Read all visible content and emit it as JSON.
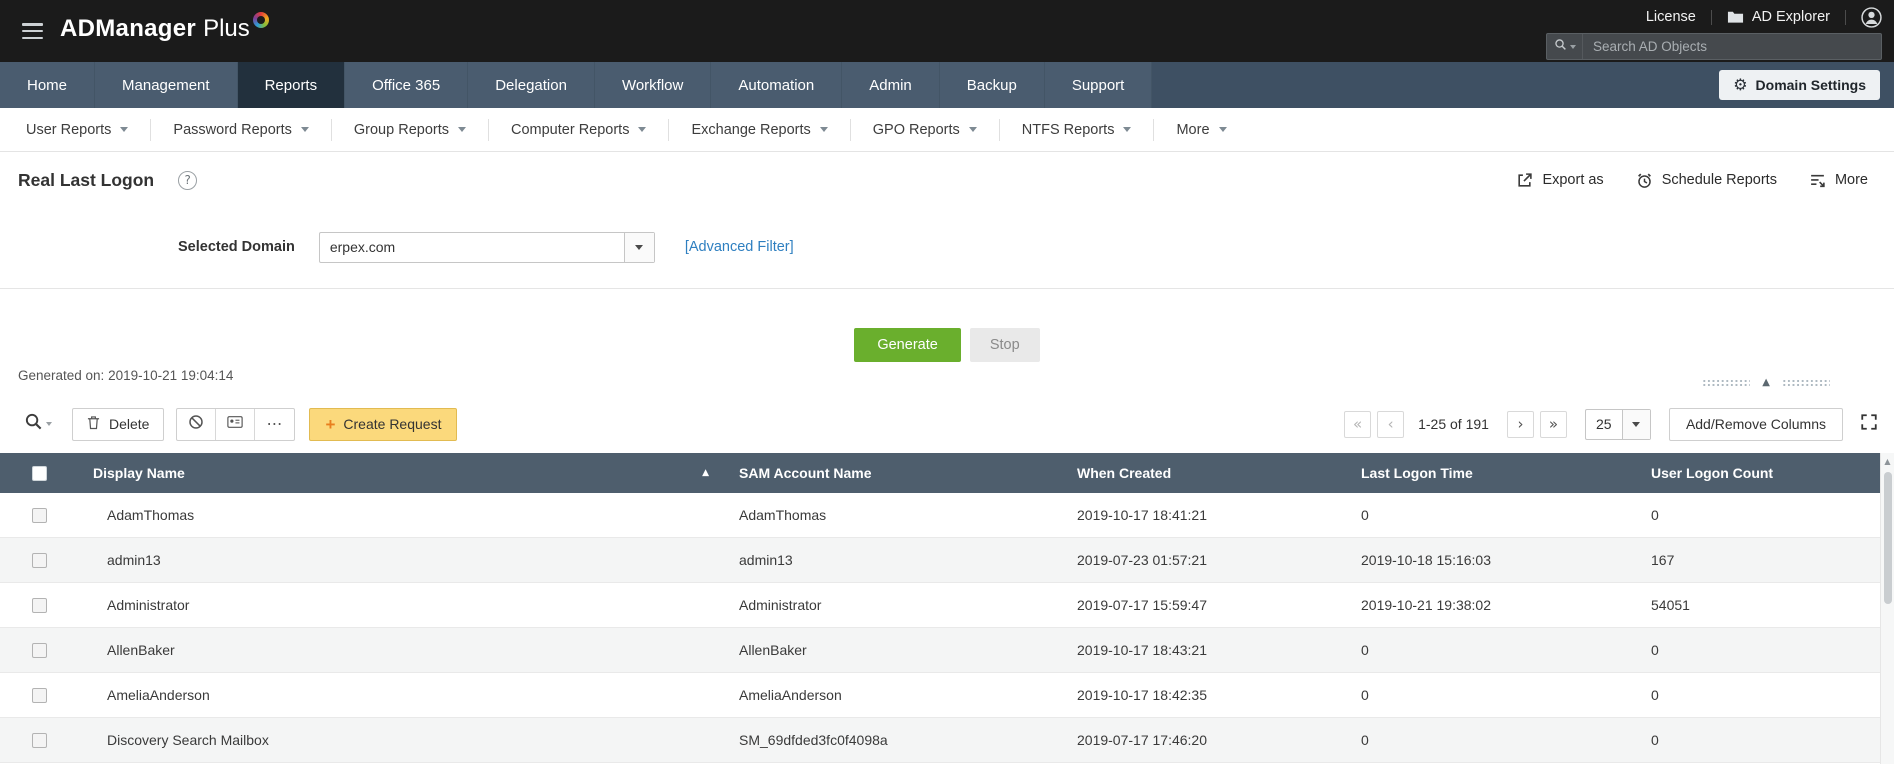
{
  "topbar": {
    "brand": {
      "primary": "ADManager",
      "secondary": "Plus"
    },
    "license_label": "License",
    "ad_explorer_label": "AD Explorer",
    "search_placeholder": "Search AD Objects"
  },
  "nav": {
    "tabs": [
      {
        "label": "Home"
      },
      {
        "label": "Management"
      },
      {
        "label": "Reports",
        "active": true
      },
      {
        "label": "Office 365"
      },
      {
        "label": "Delegation"
      },
      {
        "label": "Workflow"
      },
      {
        "label": "Automation"
      },
      {
        "label": "Admin"
      },
      {
        "label": "Backup"
      },
      {
        "label": "Support"
      }
    ],
    "domain_settings_label": "Domain Settings"
  },
  "subnav": {
    "items": [
      "User Reports",
      "Password Reports",
      "Group Reports",
      "Computer Reports",
      "Exchange Reports",
      "GPO Reports",
      "NTFS Reports",
      "More"
    ]
  },
  "page": {
    "title": "Real Last Logon",
    "export_label": "Export as",
    "schedule_label": "Schedule Reports",
    "more_label": "More"
  },
  "filter": {
    "domain_label": "Selected Domain",
    "domain_value": "erpex.com",
    "advanced_filter_label": "[Advanced Filter]"
  },
  "generate": {
    "generate_label": "Generate",
    "stop_label": "Stop"
  },
  "generated_on": "Generated on: 2019-10-21 19:04:14",
  "toolbar": {
    "delete_label": "Delete",
    "create_request_label": "Create Request",
    "pagination": {
      "range": "1-25 of 191",
      "page_size": "25"
    },
    "add_remove_columns_label": "Add/Remove Columns"
  },
  "table": {
    "columns": [
      "Display Name",
      "SAM Account Name",
      "When Created",
      "Last Logon Time",
      "User Logon Count"
    ],
    "rows": [
      [
        "AdamThomas",
        "AdamThomas",
        "2019-10-17 18:41:21",
        "0",
        "0"
      ],
      [
        "admin13",
        "admin13",
        "2019-07-23 01:57:21",
        "2019-10-18 15:16:03",
        "167"
      ],
      [
        "Administrator",
        "Administrator",
        "2019-07-17 15:59:47",
        "2019-10-21 19:38:02",
        "54051"
      ],
      [
        "AllenBaker",
        "AllenBaker",
        "2019-10-17 18:43:21",
        "0",
        "0"
      ],
      [
        "AmeliaAnderson",
        "AmeliaAnderson",
        "2019-10-17 18:42:35",
        "0",
        "0"
      ],
      [
        "Discovery Search Mailbox",
        "SM_69dfded3fc0f4098a",
        "2019-07-17 17:46:20",
        "0",
        "0"
      ]
    ]
  },
  "icons": {
    "first": "«",
    "prev": "‹",
    "next": "›",
    "last": "»",
    "sort_asc": "▲",
    "collapse": "▲",
    "scroll_up": "▲",
    "ellipsis": "⋯",
    "plus": "+",
    "question": "?",
    "gear": "⚙"
  },
  "colors": {
    "topbar_bg": "#1b1b1b",
    "nav_bg": "#3e5063",
    "nav_tab_bg": "#4a5c6f",
    "nav_tab_active_bg": "#22303d",
    "table_header_bg": "#4e5e6d",
    "generate_green": "#6aaf2d",
    "create_request_amber": "#fbd97c",
    "link_blue": "#2e7fc0"
  }
}
